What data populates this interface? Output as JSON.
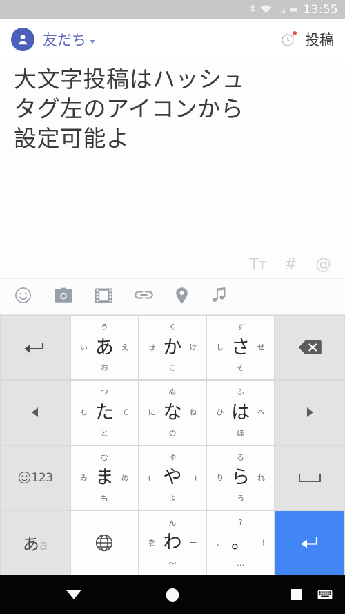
{
  "statusbar": {
    "time": "13:55",
    "icons": [
      "bluetooth-icon",
      "wifi-icon",
      "cellular-signal-icon",
      "battery-icon"
    ]
  },
  "header": {
    "avatar_icon": "person-avatar-icon",
    "audience_label": "友だち",
    "audience_caret_icon": "chevron-down-icon",
    "timer_icon": "timer-clock-icon",
    "timer_badge": "red-dot-badge",
    "post_label": "投稿"
  },
  "compose": {
    "text": "大文字投稿はハッシュ\nタグ左のアイコンから\n設定可能よ",
    "format_tools": [
      {
        "name": "text-size-icon",
        "label": "Tᴛ"
      },
      {
        "name": "hashtag-icon",
        "label": "#"
      },
      {
        "name": "mention-icon",
        "label": "@"
      }
    ]
  },
  "media_bar": {
    "items": [
      {
        "name": "emoji-icon",
        "label": "emoji"
      },
      {
        "name": "camera-icon",
        "label": "camera"
      },
      {
        "name": "video-icon",
        "label": "video"
      },
      {
        "name": "link-icon",
        "label": "link"
      },
      {
        "name": "location-pin-icon",
        "label": "location"
      },
      {
        "name": "music-note-icon",
        "label": "music"
      }
    ]
  },
  "keyboard": {
    "theme": {
      "key_bg": "#fdfdfd",
      "fn_bg": "#e3e3e3",
      "board_bg": "#d9d9d9",
      "enter_bg": "#4285f4"
    },
    "rows": [
      {
        "left": {
          "name": "undo-key",
          "icon": "undo-arrow-icon",
          "label": ""
        },
        "keys": [
          {
            "name": "key-a",
            "center": "あ",
            "up": "う",
            "left": "い",
            "right": "え",
            "down": "お"
          },
          {
            "name": "key-ka",
            "center": "か",
            "up": "く",
            "left": "き",
            "right": "け",
            "down": "こ"
          },
          {
            "name": "key-sa",
            "center": "さ",
            "up": "す",
            "left": "し",
            "right": "せ",
            "down": "そ"
          }
        ],
        "right": {
          "name": "delete-key",
          "icon": "backspace-icon",
          "label": ""
        }
      },
      {
        "left": {
          "name": "cursor-left-key",
          "icon": "triangle-left-icon",
          "label": ""
        },
        "keys": [
          {
            "name": "key-ta",
            "center": "た",
            "up": "つ",
            "left": "ち",
            "right": "て",
            "down": "と"
          },
          {
            "name": "key-na",
            "center": "な",
            "up": "ぬ",
            "left": "に",
            "right": "ね",
            "down": "の"
          },
          {
            "name": "key-ha",
            "center": "は",
            "up": "ふ",
            "left": "ひ",
            "right": "へ",
            "down": "ほ"
          }
        ],
        "right": {
          "name": "cursor-right-key",
          "icon": "triangle-right-icon",
          "label": ""
        }
      },
      {
        "left": {
          "name": "symbol-number-key",
          "icon": "smiley-icon",
          "label": "123"
        },
        "keys": [
          {
            "name": "key-ma",
            "center": "ま",
            "up": "む",
            "left": "み",
            "right": "め",
            "down": "も"
          },
          {
            "name": "key-ya",
            "center": "や",
            "up": "ゆ",
            "left": "(",
            "right": ")",
            "down": "よ"
          },
          {
            "name": "key-ra",
            "center": "ら",
            "up": "る",
            "left": "り",
            "right": "れ",
            "down": "ろ"
          }
        ],
        "right": {
          "name": "space-key",
          "icon": "space-bar-icon",
          "label": ""
        }
      },
      {
        "left": {
          "name": "input-mode-key",
          "icon": "",
          "label": "あa"
        },
        "keys": [
          {
            "name": "language-key",
            "center": "",
            "up": "",
            "left": "",
            "right": "",
            "down": "",
            "icon": "globe-icon"
          },
          {
            "name": "key-wa",
            "center": "わ",
            "up": "ん",
            "left": "を",
            "right": "ー",
            "down": "〜"
          },
          {
            "name": "key-punctuation",
            "center": "。",
            "up": "?",
            "left": "、",
            "right": "!",
            "down": "…"
          }
        ],
        "right": {
          "name": "enter-key",
          "icon": "enter-return-icon",
          "label": ""
        }
      }
    ]
  },
  "navbar": {
    "buttons": [
      {
        "name": "nav-back-button",
        "icon": "triangle-down-icon"
      },
      {
        "name": "nav-home-button",
        "icon": "circle-icon"
      },
      {
        "name": "nav-recents-button",
        "icon": "square-icon"
      },
      {
        "name": "nav-keyboard-switch-button",
        "icon": "keyboard-icon"
      }
    ]
  }
}
